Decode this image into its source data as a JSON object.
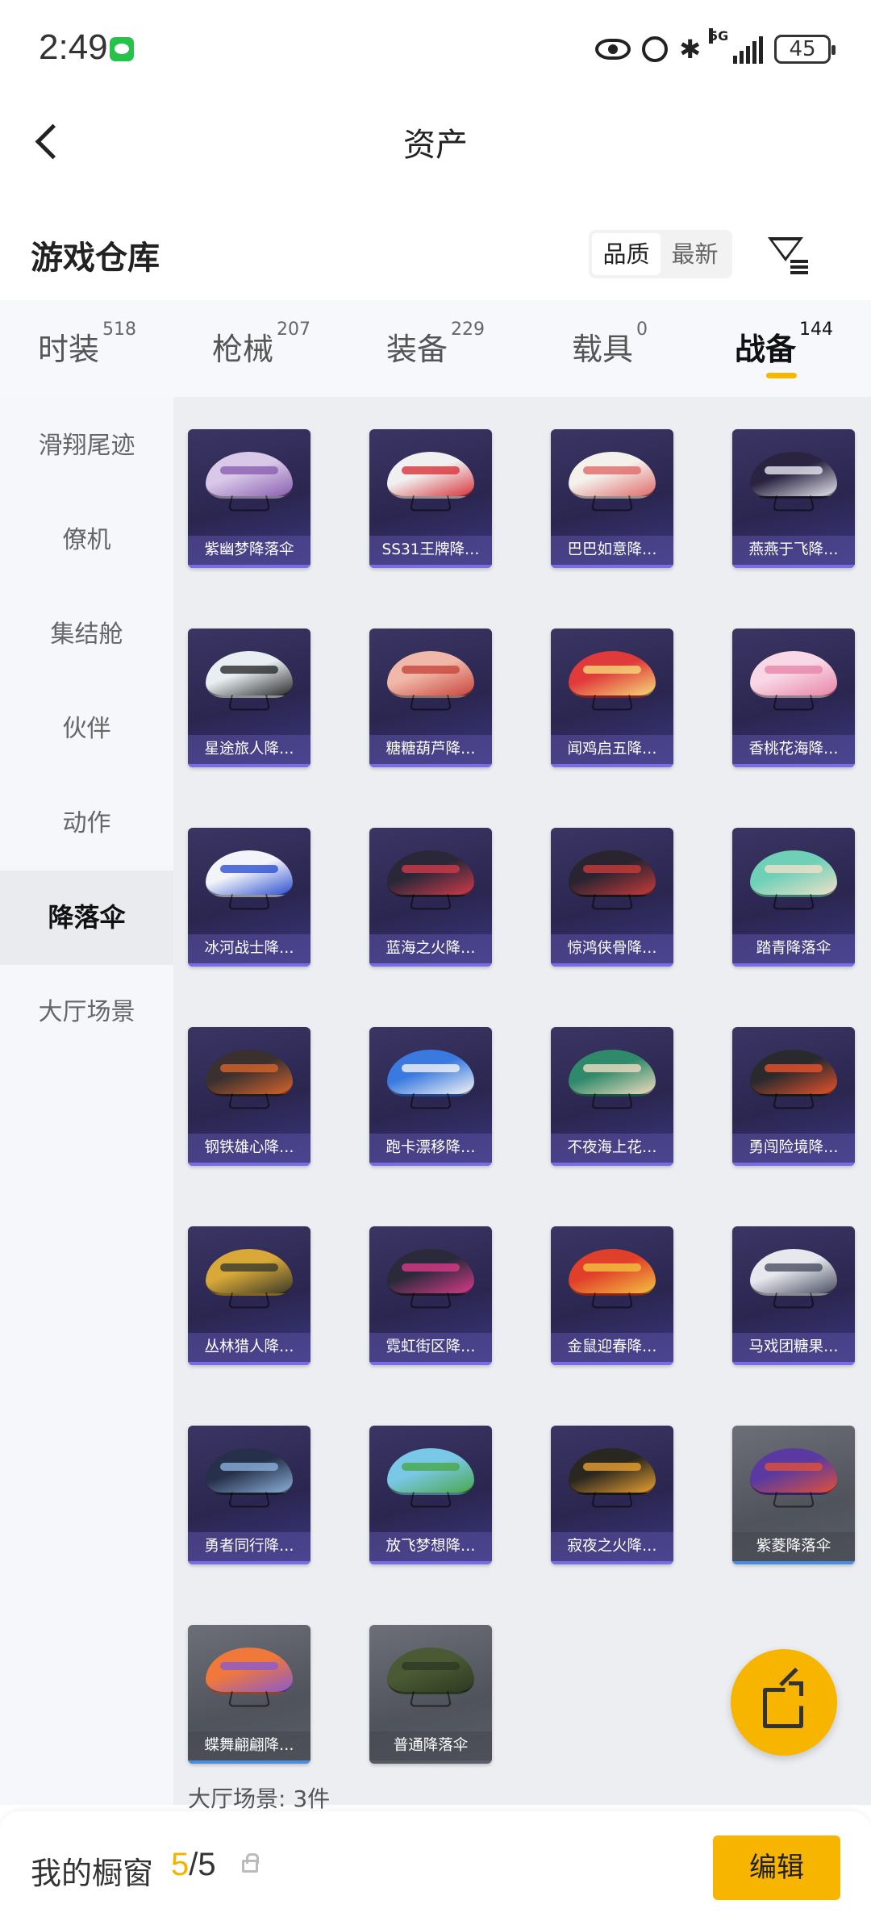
{
  "status_bar": {
    "time": "2:49",
    "battery": "45",
    "network": "5G"
  },
  "header": {
    "title": "资产"
  },
  "warehouse": {
    "title": "游戏仓库",
    "sort_options": [
      "品质",
      "最新"
    ]
  },
  "tabs": [
    {
      "name": "时装",
      "count": "518"
    },
    {
      "name": "枪械",
      "count": "207"
    },
    {
      "name": "装备",
      "count": "229"
    },
    {
      "name": "载具",
      "count": "0"
    },
    {
      "name": "战备",
      "count": "144"
    }
  ],
  "sidebar": {
    "items": [
      "滑翔尾迹",
      "僚机",
      "集结舱",
      "伙伴",
      "动作",
      "降落伞",
      "大厅场景"
    ],
    "active_index": 5
  },
  "items": [
    {
      "name": "紫幽梦降落伞",
      "colors": [
        "#d9c8e8",
        "#8a5fb0"
      ],
      "grey": false
    },
    {
      "name": "SS31王牌降…",
      "colors": [
        "#f0f0f0",
        "#d8333a"
      ],
      "grey": false
    },
    {
      "name": "巴巴如意降…",
      "colors": [
        "#f4f0ea",
        "#e06a6a"
      ],
      "grey": false
    },
    {
      "name": "燕燕于飞降…",
      "colors": [
        "#2a2440",
        "#e6e6f0"
      ],
      "grey": false
    },
    {
      "name": "星途旅人降…",
      "colors": [
        "#e8eef2",
        "#2a2a2a"
      ],
      "grey": false
    },
    {
      "name": "糖糖葫芦降…",
      "colors": [
        "#f0b8a8",
        "#c8463c"
      ],
      "grey": false
    },
    {
      "name": "闻鸡启五降…",
      "colors": [
        "#e03a3a",
        "#f6d97a"
      ],
      "grey": false
    },
    {
      "name": "香桃花海降…",
      "colors": [
        "#f8d8e4",
        "#e884a8"
      ],
      "grey": false
    },
    {
      "name": "冰河战士降…",
      "colors": [
        "#f2f4fa",
        "#2d4fd0"
      ],
      "grey": false
    },
    {
      "name": "蓝海之火降…",
      "colors": [
        "#2a2838",
        "#d03a4a"
      ],
      "grey": false
    },
    {
      "name": "惊鸿侠骨降…",
      "colors": [
        "#2a2430",
        "#c83a3a"
      ],
      "grey": false
    },
    {
      "name": "踏青降落伞",
      "colors": [
        "#6fd0b8",
        "#f0e0c8"
      ],
      "grey": false
    },
    {
      "name": "钢铁雄心降…",
      "colors": [
        "#3a3030",
        "#d8642a"
      ],
      "grey": false
    },
    {
      "name": "跑卡漂移降…",
      "colors": [
        "#3a7ae0",
        "#f4f4f4"
      ],
      "grey": false
    },
    {
      "name": "不夜海上花…",
      "colors": [
        "#2e8a6a",
        "#f0dcc0"
      ],
      "grey": false
    },
    {
      "name": "勇闯险境降…",
      "colors": [
        "#2a2a2e",
        "#e8522a"
      ],
      "grey": false
    },
    {
      "name": "丛林猎人降…",
      "colors": [
        "#d8a838",
        "#3a3a2a"
      ],
      "grey": false
    },
    {
      "name": "霓虹街区降…",
      "colors": [
        "#2a2a3a",
        "#d83a8a"
      ],
      "grey": false
    },
    {
      "name": "金鼠迎春降…",
      "colors": [
        "#e0402a",
        "#f4c040"
      ],
      "grey": false
    },
    {
      "name": "马戏团糖果…",
      "colors": [
        "#e6e8ee",
        "#4a4e60"
      ],
      "grey": false
    },
    {
      "name": "勇者同行降…",
      "colors": [
        "#26304a",
        "#8ab0d8"
      ],
      "grey": false
    },
    {
      "name": "放飞梦想降…",
      "colors": [
        "#7ac8e8",
        "#4aa84a"
      ],
      "grey": false
    },
    {
      "name": "寂夜之火降…",
      "colors": [
        "#2a2620",
        "#e8a030"
      ],
      "grey": false
    },
    {
      "name": "紫菱降落伞",
      "colors": [
        "#5a3aa0",
        "#e0503a"
      ],
      "grey": true
    },
    {
      "name": "蝶舞翩翩降…",
      "colors": [
        "#f0783a",
        "#8a5ad0"
      ],
      "grey": true
    },
    {
      "name": "普通降落伞",
      "colors": [
        "#4a5a34",
        "#2e3a22"
      ],
      "grey": true
    }
  ],
  "count_label": "大厅场景: 3件",
  "bottom": {
    "window_label": "我的橱窗",
    "window_current": "5",
    "window_total": "/5",
    "edit_label": "编辑"
  },
  "accent_color": "#f8b500"
}
